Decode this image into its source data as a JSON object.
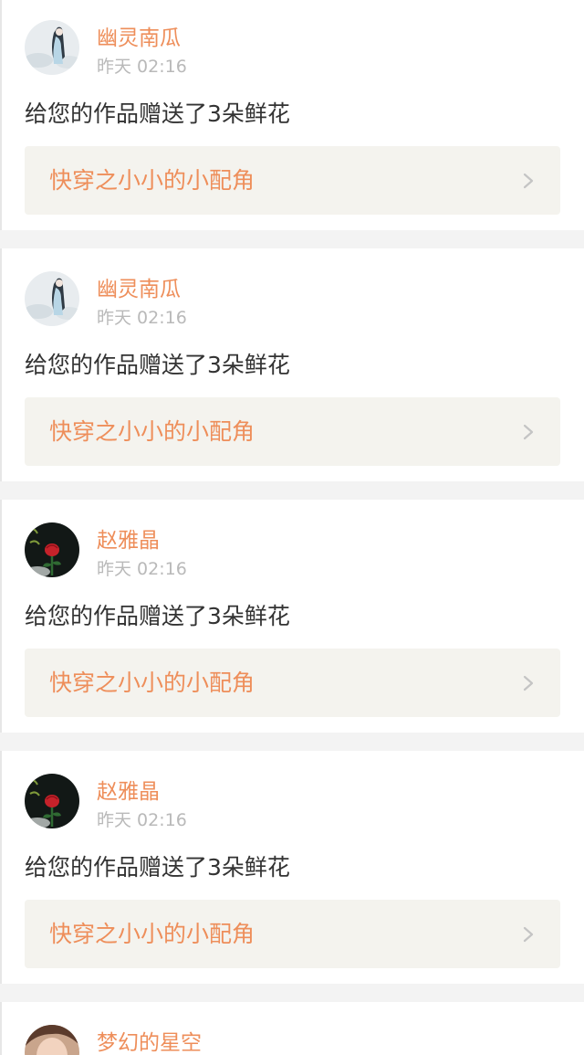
{
  "notifications": [
    {
      "user": {
        "name": "幽灵南瓜",
        "avatar_icon": "ghost-girl-avatar"
      },
      "time": "昨天 02:16",
      "message": "给您的作品赠送了3朵鲜花",
      "work_title": "快穿之小小的小配角"
    },
    {
      "user": {
        "name": "幽灵南瓜",
        "avatar_icon": "ghost-girl-avatar"
      },
      "time": "昨天 02:16",
      "message": "给您的作品赠送了3朵鲜花",
      "work_title": "快穿之小小的小配角"
    },
    {
      "user": {
        "name": "赵雅晶",
        "avatar_icon": "red-rose-avatar"
      },
      "time": "昨天 02:16",
      "message": "给您的作品赠送了3朵鲜花",
      "work_title": "快穿之小小的小配角"
    },
    {
      "user": {
        "name": "赵雅晶",
        "avatar_icon": "red-rose-avatar"
      },
      "time": "昨天 02:16",
      "message": "给您的作品赠送了3朵鲜花",
      "work_title": "快穿之小小的小配角"
    },
    {
      "user": {
        "name": "梦幻的星空",
        "avatar_icon": "person-face-avatar"
      }
    }
  ],
  "colors": {
    "accent": "#ee8e5a",
    "text": "#333333",
    "muted": "#b9b9b9",
    "link_background": "#f4f3ee",
    "page_background": "#f3f3f3"
  }
}
